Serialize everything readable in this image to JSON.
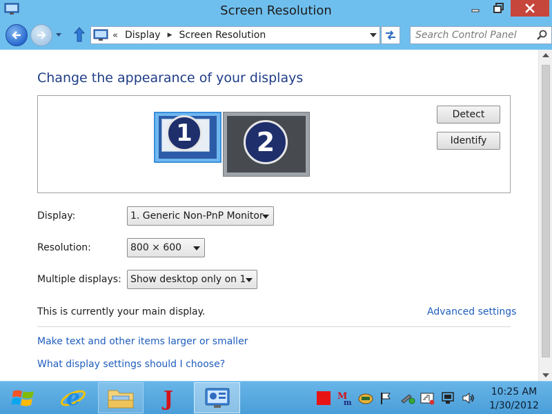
{
  "window": {
    "title": "Screen Resolution"
  },
  "navigation": {
    "breadcrumb": [
      "Display",
      "Screen Resolution"
    ],
    "search_placeholder": "Search Control Panel"
  },
  "content": {
    "heading": "Change the appearance of your displays",
    "monitors": [
      {
        "number": "1",
        "selected": true
      },
      {
        "number": "2",
        "selected": false
      }
    ],
    "detect_label": "Detect",
    "identify_label": "Identify",
    "display_label": "Display:",
    "display_value": "1. Generic Non-PnP Monitor",
    "resolution_label": "Resolution:",
    "resolution_value": "800 × 600",
    "multiple_label": "Multiple displays:",
    "multiple_value": "Show desktop only on 1",
    "main_display_text": "This is currently your main display.",
    "advanced_link": "Advanced settings",
    "link_text_size": "Make text and other items larger or smaller",
    "link_choose": "What display settings should I choose?"
  },
  "taskbar": {
    "items": [
      "internet-explorer",
      "file-explorer",
      "j-app",
      "control-panel"
    ],
    "active_item": "control-panel",
    "tray_icons": [
      "red-square-icon",
      "mm-icon",
      "network-app-icon",
      "flag-icon",
      "wrench-icon",
      "wifi-icon",
      "monitor-tray-icon",
      "volume-icon"
    ],
    "clock_time": "10:25 AM",
    "clock_date": "1/30/2012"
  },
  "colors": {
    "heading": "#1e3c87",
    "link": "#1e5dbd",
    "window_frame": "#6fbfee",
    "close_button": "#c7463c"
  }
}
